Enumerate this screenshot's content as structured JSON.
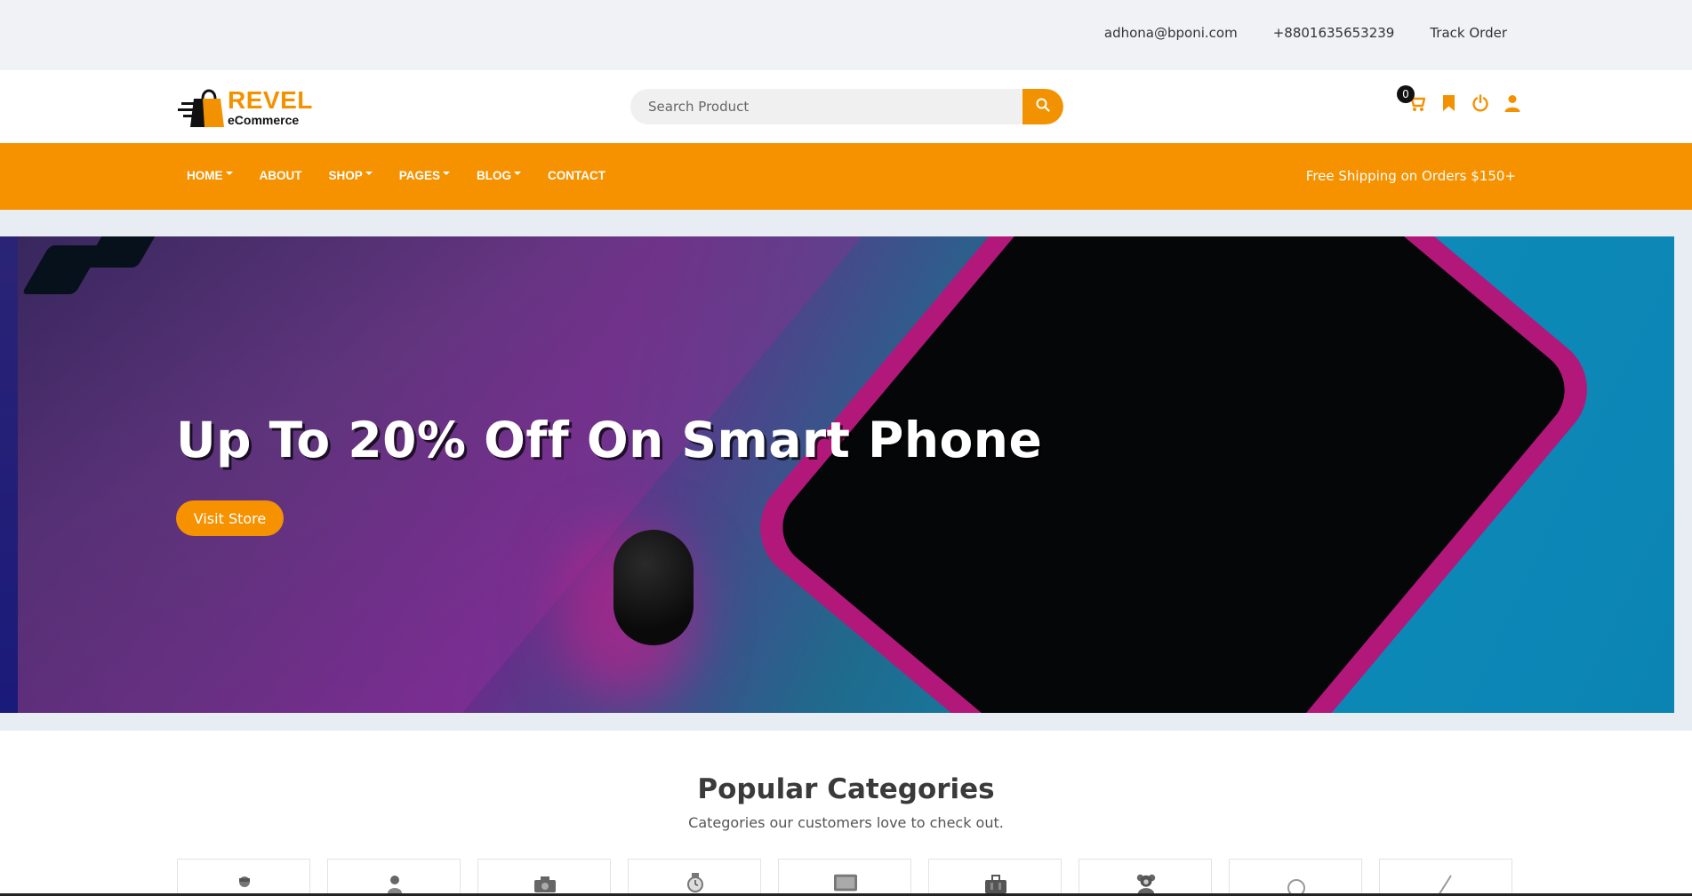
{
  "topbar": {
    "email": "adhona@bponi.com",
    "phone": "+8801635653239",
    "track_order": "Track Order"
  },
  "header": {
    "logo_title": "REVEL",
    "logo_subtitle": "eCommerce",
    "search_placeholder": "Search Product",
    "search_icon": "search-icon",
    "cart_count": "0",
    "icons": [
      "cart-icon",
      "bookmark-icon",
      "power-icon",
      "user-icon"
    ],
    "accent_color": "#f39200"
  },
  "nav": {
    "items": [
      {
        "label": "HOME",
        "dropdown": true
      },
      {
        "label": "ABOUT",
        "dropdown": false
      },
      {
        "label": "SHOP",
        "dropdown": true
      },
      {
        "label": "PAGES",
        "dropdown": true
      },
      {
        "label": "BLOG",
        "dropdown": true
      },
      {
        "label": "CONTACT",
        "dropdown": false
      }
    ],
    "promo": "Free Shipping on Orders $150+"
  },
  "hero": {
    "title": "Up To 20% Off On Smart Phone",
    "button_label": "Visit Store"
  },
  "categories": {
    "title": "Popular Categories",
    "subtitle": "Categories our customers love to check out.",
    "icons": [
      "person-icon",
      "woman-icon",
      "camera-icon",
      "watch-icon",
      "monitor-icon",
      "briefcase-icon",
      "teddy-bear-icon",
      "magnifier-icon",
      "pen-icon"
    ]
  }
}
